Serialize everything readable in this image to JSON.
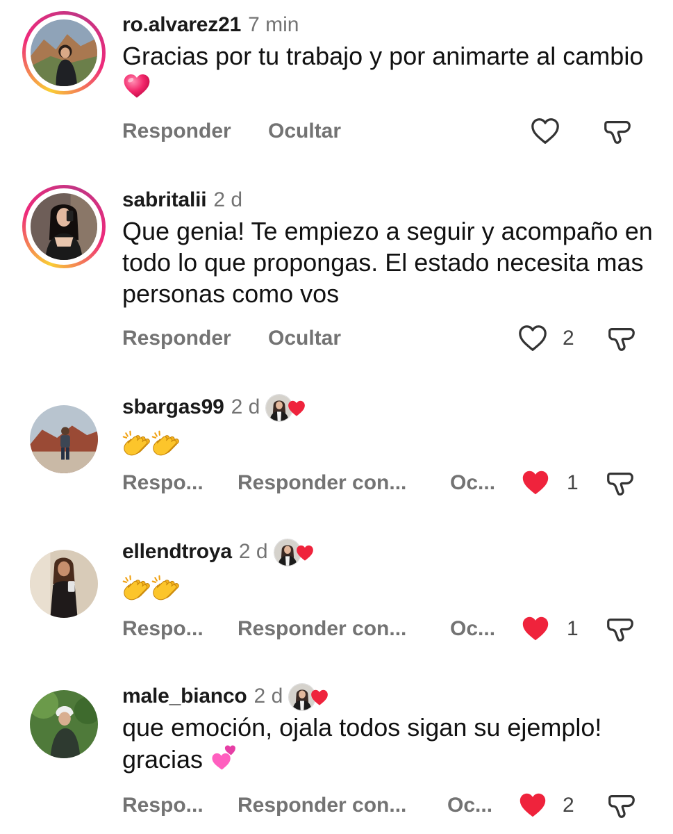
{
  "colors": {
    "liked": "#ef233c",
    "muted": "#737373",
    "text": "#111111"
  },
  "comments": [
    {
      "username": "ro.alvarez21",
      "time": "7 min",
      "text": "Gracias por tu trabajo y por animarte al cambio",
      "emoji": "red-heart",
      "actions": [
        "Responder",
        "Ocultar"
      ],
      "liked": false,
      "like_count": ""
    },
    {
      "username": "sabritalii",
      "time": "2 d",
      "text": "Que genia! Te empiezo a seguir y acompaño en todo lo que propongas. El estado necesita mas personas como vos",
      "actions": [
        "Responder",
        "Ocultar"
      ],
      "liked": false,
      "like_count": "2"
    },
    {
      "username": "sbargas99",
      "time": "2 d",
      "text": "",
      "emoji": "clapping-hands x2",
      "actions": [
        "Respo...",
        "Responder con...",
        "Oc..."
      ],
      "liked": true,
      "like_count": "1"
    },
    {
      "username": "ellendtroya",
      "time": "2 d",
      "text": "",
      "emoji": "clapping-hands x2",
      "actions": [
        "Respo...",
        "Responder con...",
        "Oc..."
      ],
      "liked": true,
      "like_count": "1"
    },
    {
      "username": "male_bianco",
      "time": "2 d",
      "text": "que emoción, ojala todos sigan su ejemplo! gracias",
      "emoji": "two-hearts",
      "actions": [
        "Respo...",
        "Responder con...",
        "Oc..."
      ],
      "liked": true,
      "like_count": "2"
    }
  ],
  "icons": {
    "like": "heart-outline-icon",
    "liked": "heart-filled-icon",
    "dislike": "thumbs-down-speech-icon"
  }
}
